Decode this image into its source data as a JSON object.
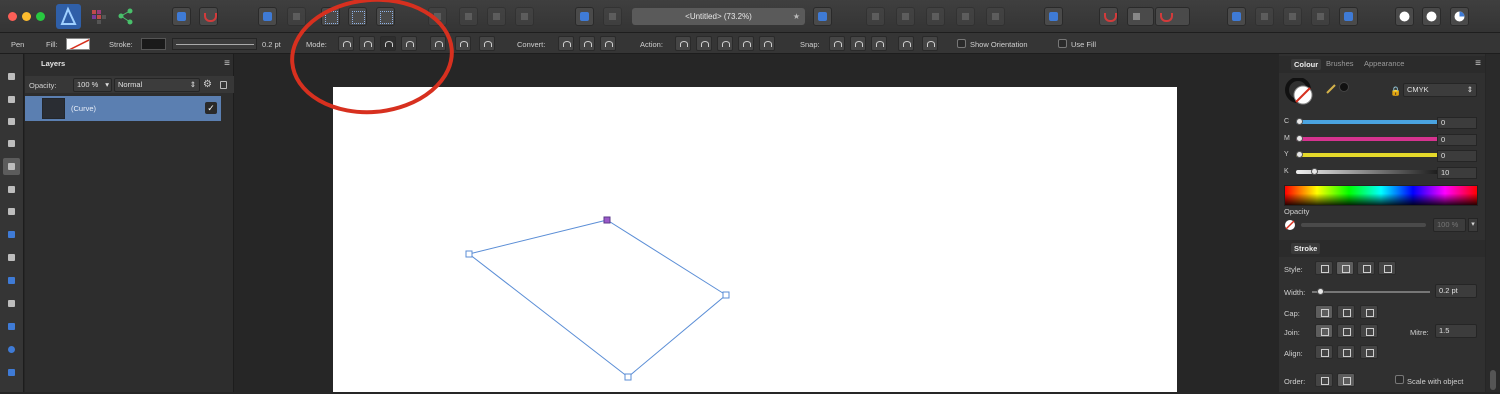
{
  "window": {
    "document_title": "<Untitled> (73.2%)",
    "tab_star": "★"
  },
  "context_toolbar": {
    "tool_name": "Pen",
    "fill_label": "Fill:",
    "stroke_label": "Stroke:",
    "stroke_width": "0.2 pt",
    "mode_label": "Mode:",
    "convert_label": "Convert:",
    "action_label": "Action:",
    "snap_label": "Snap:",
    "show_orientation_label": "Show Orientation",
    "use_fill_label": "Use Fill"
  },
  "layers_panel": {
    "tab_label": "Layers",
    "menu_glyph": "≡",
    "opacity_label": "Opacity:",
    "opacity_value": "100 %",
    "blend_mode": "Normal",
    "layer_name": "(Curve)",
    "visible_glyph": "✓"
  },
  "colour_panel": {
    "tabs": [
      "Colour",
      "Brushes",
      "Appearance"
    ],
    "menu_glyph": "≡",
    "model": "CMYK",
    "channels": [
      {
        "label": "C",
        "value": "0",
        "level": 0
      },
      {
        "label": "M",
        "value": "0",
        "level": 0
      },
      {
        "label": "Y",
        "value": "0",
        "level": 0
      },
      {
        "label": "K",
        "value": "10",
        "level": 10
      }
    ],
    "opacity_label": "Opacity",
    "opacity_value": "100 %",
    "colors": {
      "cyan": "#4aa3e0",
      "magenta": "#d6338f",
      "yellow": "#e5d92a",
      "key": "#1a1a1a"
    }
  },
  "stroke_panel": {
    "tab_label": "Stroke",
    "style_label": "Style:",
    "width_label": "Width:",
    "width_value": "0.2 pt",
    "cap_label": "Cap:",
    "join_label": "Join:",
    "mitre_label": "Mitre:",
    "mitre_value": "1.5",
    "align_label": "Align:",
    "order_label": "Order:",
    "scale_with_object_label": "Scale with object"
  },
  "accent_colors": {
    "selection": "#5b7fb1",
    "curve": "#5b8ed6",
    "annotation": "#d7301f"
  }
}
